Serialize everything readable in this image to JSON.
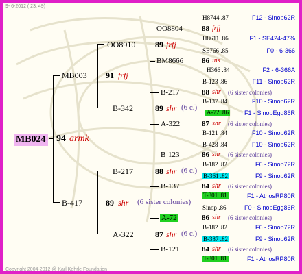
{
  "header": {
    "date": "9- 6-2012 ( 23: 49)"
  },
  "footer": {
    "copyright": "Copyright 2004-2012 @ Karl Kehrle Foundation"
  },
  "colors": {
    "border": "#e020c8",
    "breed": "#cc0000",
    "note": "#5a3a9a",
    "source": "#0000cc",
    "root_bg": "#f0b4f0",
    "green_highlight": "#20d020",
    "cyan_highlight": "#00e8f0"
  },
  "root": {
    "code": "MB024",
    "year": "94",
    "breed": "armk"
  },
  "gen1": [
    {
      "code": "MB003",
      "year": "91",
      "breed": "frfj"
    },
    {
      "code": "B-417",
      "year": "89",
      "breed": "shr",
      "note": "(6 sister colonies)"
    }
  ],
  "gen2": [
    {
      "code": "OO8910",
      "year": "89",
      "breed": "frfj"
    },
    {
      "code": "B-342",
      "year": "89",
      "breed": "shr",
      "note": "(6 c.)"
    },
    {
      "code": "B-217",
      "year": "88",
      "breed": "shr",
      "note": "(6 c.)"
    },
    {
      "code": "A-322",
      "year": "87",
      "breed": "shr",
      "note": "(6 c.)"
    }
  ],
  "gen3": [
    {
      "code": "OO8804",
      "year": "88",
      "breed": "frfj"
    },
    {
      "code": "BM8666",
      "year": "86",
      "breed": "ins"
    },
    {
      "code": "B-217",
      "year": "88",
      "breed": "shr",
      "note": "(6 sister colonies)"
    },
    {
      "code": "A-322",
      "year": "87",
      "breed": "shr",
      "note": "(6 sister colonies)"
    },
    {
      "code": "B-123",
      "year": "86",
      "breed": "shr",
      "note": "(6 sister colonies)"
    },
    {
      "code": "B-137",
      "year": "84",
      "breed": "shr",
      "note": "(6 sister colonies)"
    },
    {
      "code": "A-72",
      "year": "86",
      "breed": "shr",
      "note": "(6 sister colonies)"
    },
    {
      "code": "B-121",
      "year": "84",
      "breed": "shr",
      "note": "(6 sister colonies)"
    }
  ],
  "gen4": [
    {
      "code": "H8744 .87",
      "source": "F12 - Sinop62R"
    },
    {
      "code": "H8611 .86",
      "source": "F1 - SE424-47%"
    },
    {
      "code": "SE766 .85",
      "source": "F0 - 6-366"
    },
    {
      "code": "H366 .84",
      "source": "F2 - 6-366A"
    },
    {
      "code": "B-123 .86",
      "source": "F11 - Sinop62R"
    },
    {
      "code": "B-137 .84",
      "source": "F10 - Sinop62R"
    },
    {
      "code": "A-72 .86",
      "source": "F1 - SinopEgg86R"
    },
    {
      "code": "B-121 .84",
      "source": "F10 - Sinop62R"
    },
    {
      "code": "B-428 .84",
      "source": "F10 - Sinop62R"
    },
    {
      "code": "B-182 .82",
      "source": "F6 - Sinop72R"
    },
    {
      "code": "B-361 .82",
      "source": "F9 - Sinop62R"
    },
    {
      "code": "T-301 .81",
      "source": "F1 - AthosRP80R"
    },
    {
      "code": "Sinop .86",
      "source": "F0 - SinopEgg86R"
    },
    {
      "code": "B-182 .82",
      "source": "F6 - Sinop72R"
    },
    {
      "code": "B-387 .82",
      "source": "F9 - Sinop62R"
    },
    {
      "code": "T-301 .81",
      "source": "F1 - AthosRP80R"
    }
  ]
}
